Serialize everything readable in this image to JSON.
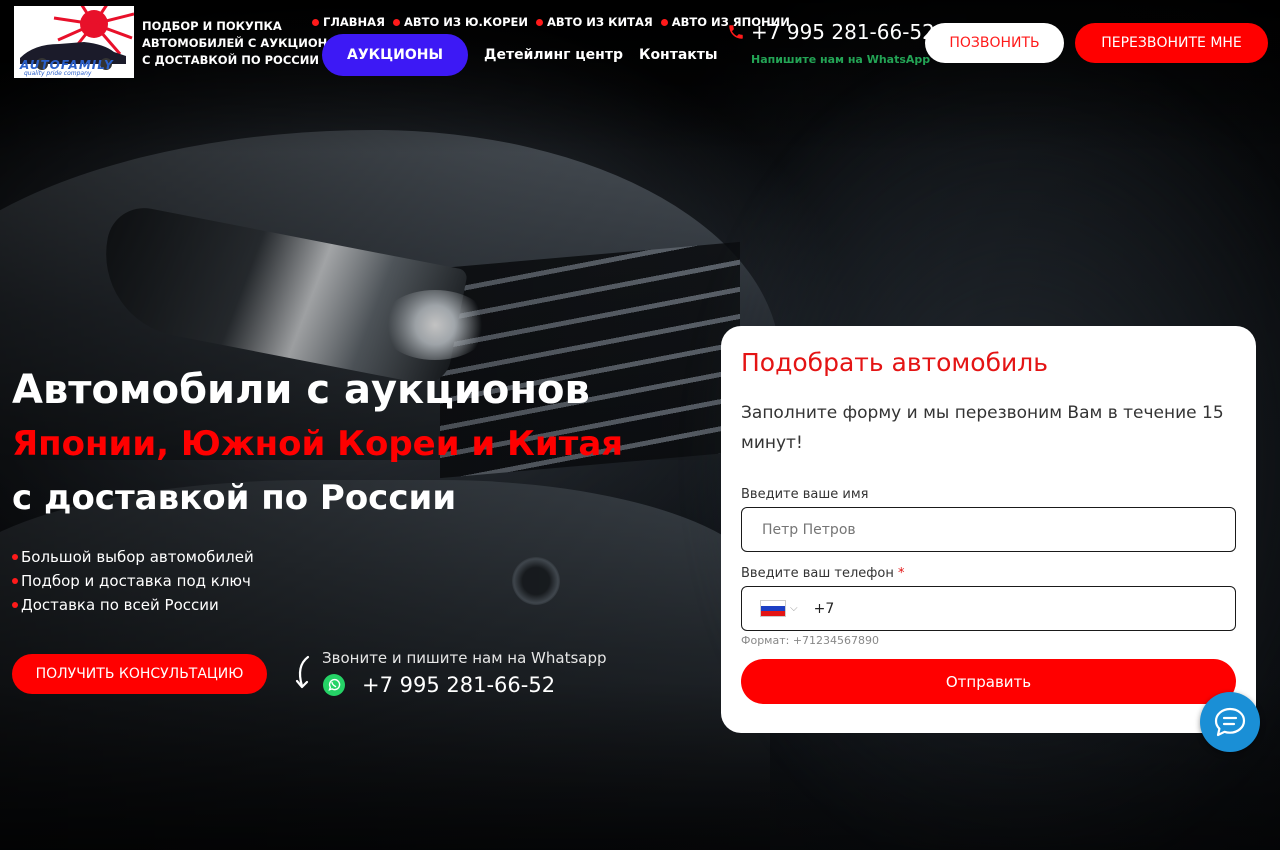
{
  "brand": {
    "logo_text": "AUTOFAMILY",
    "logo_subtext": "quality pride company",
    "tagline_lines": [
      "ПОДБОР И ПОКУПКА",
      "АВТОМОБИЛЕЙ С АУКЦИОНОВ",
      "С ДОСТАВКОЙ ПО РОССИИ"
    ]
  },
  "nav": {
    "top_items": [
      "ГЛАВНАЯ",
      "АВТО ИЗ Ю.КОРЕИ",
      "АВТО ИЗ КИТАЯ",
      "АВТО ИЗ ЯПОНИИ"
    ],
    "auctions_label": "АУКЦИОНЫ",
    "sub_items": [
      "Детейлинг центр",
      "Контакты"
    ]
  },
  "contact": {
    "phone": "+7 995 281-66-52",
    "whatsapp_hint": "Напишите нам на WhatsApp",
    "call_label": "ПОЗВОНИТЬ",
    "callback_label": "ПЕРЕЗВОНИТЕ МНЕ"
  },
  "hero": {
    "title_line1": "Автомобили с аукционов",
    "title_line2": "Японии, Южной Кореи и Китая",
    "title_line3": "с доставкой по России",
    "bullets": [
      "Большой выбор автомобилей",
      "Подбор и доставка под ключ",
      "Доставка по всей России"
    ],
    "consult_label": "ПОЛУЧИТЬ КОНСУЛЬТАЦИЮ",
    "whatsapp_hint": "Звоните и пишите нам на Whatsapp",
    "whatsapp_phone": "+7 995 281-66-52"
  },
  "form": {
    "title": "Подобрать автомобиль",
    "description": "Заполните форму и мы перезвоним Вам в течение 15 минут!",
    "name_label": "Введите ваше имя",
    "name_placeholder": "Петр Петров",
    "phone_label": "Введите ваш телефон",
    "phone_required": "*",
    "phone_value": "+7",
    "phone_format": "Формат: +71234567890",
    "submit_label": "Отправить"
  },
  "colors": {
    "accent_red": "#ff0000",
    "auctions_blue": "#3d19f5",
    "whatsapp_green": "#23a455",
    "chat_blue": "#1a8fd6"
  },
  "icons": [
    "logo-icon",
    "phone-icon",
    "curved-arrow-icon",
    "whatsapp-icon",
    "russia-flag-icon",
    "chevron-down-icon",
    "chat-icon"
  ]
}
